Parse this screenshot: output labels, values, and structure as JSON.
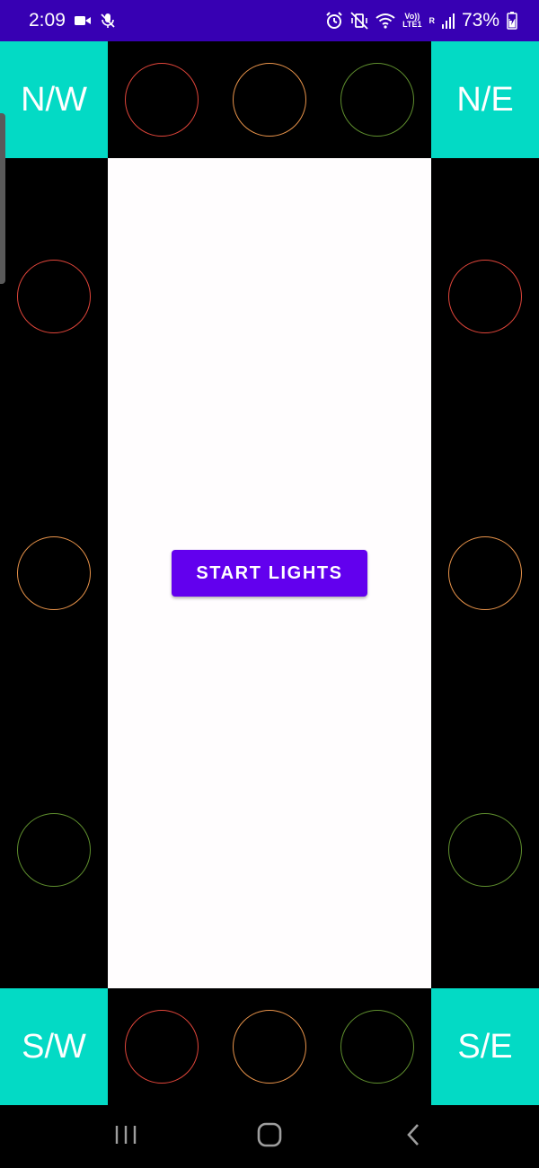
{
  "status_bar": {
    "time": "2:09",
    "volte_top": "Vo))",
    "volte_bottom": "LTE1",
    "roaming": "R",
    "battery": "73%",
    "icons": [
      "video-camera-icon",
      "mute-mic-icon",
      "alarm-icon",
      "vibrate-icon",
      "wifi-icon",
      "signal-icon",
      "battery-icon"
    ]
  },
  "corners": {
    "nw": "N/W",
    "ne": "N/E",
    "sw": "S/W",
    "se": "S/E"
  },
  "colors": {
    "status_bar": "#3700b3",
    "corner": "#03dac5",
    "button": "#6200ee",
    "red_light": "#e0453a",
    "amber_light": "#e8934a",
    "green_light": "#5f8f2e"
  },
  "button": {
    "start_label": "START LIGHTS"
  },
  "nav": {
    "icons": [
      "recent-apps-icon",
      "home-icon",
      "back-icon"
    ]
  }
}
